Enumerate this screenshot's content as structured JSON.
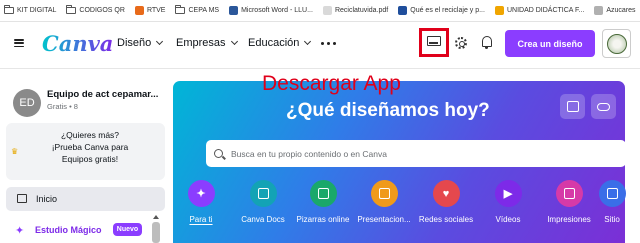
{
  "bookmarks": [
    {
      "label": "KIT DIGITAL",
      "icon": "folder-icon"
    },
    {
      "label": "CODIGOS QR",
      "icon": "folder-icon"
    },
    {
      "label": "RTVE",
      "icon": "rtve-favicon"
    },
    {
      "label": "CEPA MS",
      "icon": "folder-icon"
    },
    {
      "label": "Microsoft Word - LLU...",
      "icon": "word-favicon"
    },
    {
      "label": "Reciclatuvida.pdf",
      "icon": "pdf-favicon"
    },
    {
      "label": "Qué es el reciclaje y p...",
      "icon": "site-favicon"
    },
    {
      "label": "UNIDAD DIDÁCTICA F...",
      "icon": "site-favicon"
    },
    {
      "label": "Azucares",
      "icon": "site-favicon"
    }
  ],
  "header": {
    "logo": "Canva",
    "nav": [
      "Diseño",
      "Empresas",
      "Educación"
    ],
    "cta": "Crea un diseño"
  },
  "sidebar": {
    "avatar_initials": "ED",
    "team_name": "Equipo de act cepamar...",
    "team_meta": "Gratis • 8",
    "promo_line1": "¿Quieres más?",
    "promo_line2": "¡Prueba Canva para",
    "promo_line3": "Equipos gratis!",
    "menu_home": "Inicio",
    "menu_magic": "Estudio Mágico",
    "badge": "Nuevo"
  },
  "annotation": "Descargar App",
  "hero": {
    "title": "¿Qué diseñamos hoy?",
    "search_placeholder": "Busca en tu propio contenido o en Canva",
    "categories": [
      "Para ti",
      "Canva Docs",
      "Pizarras online",
      "Presentacion...",
      "Redes sociales",
      "Vídeos",
      "Impresiones",
      "Sitio"
    ]
  },
  "colors": {
    "accent": "#8b3dff",
    "annotation": "#e0001a",
    "hero_start": "#00b6d6",
    "hero_end": "#7b2fd6"
  }
}
